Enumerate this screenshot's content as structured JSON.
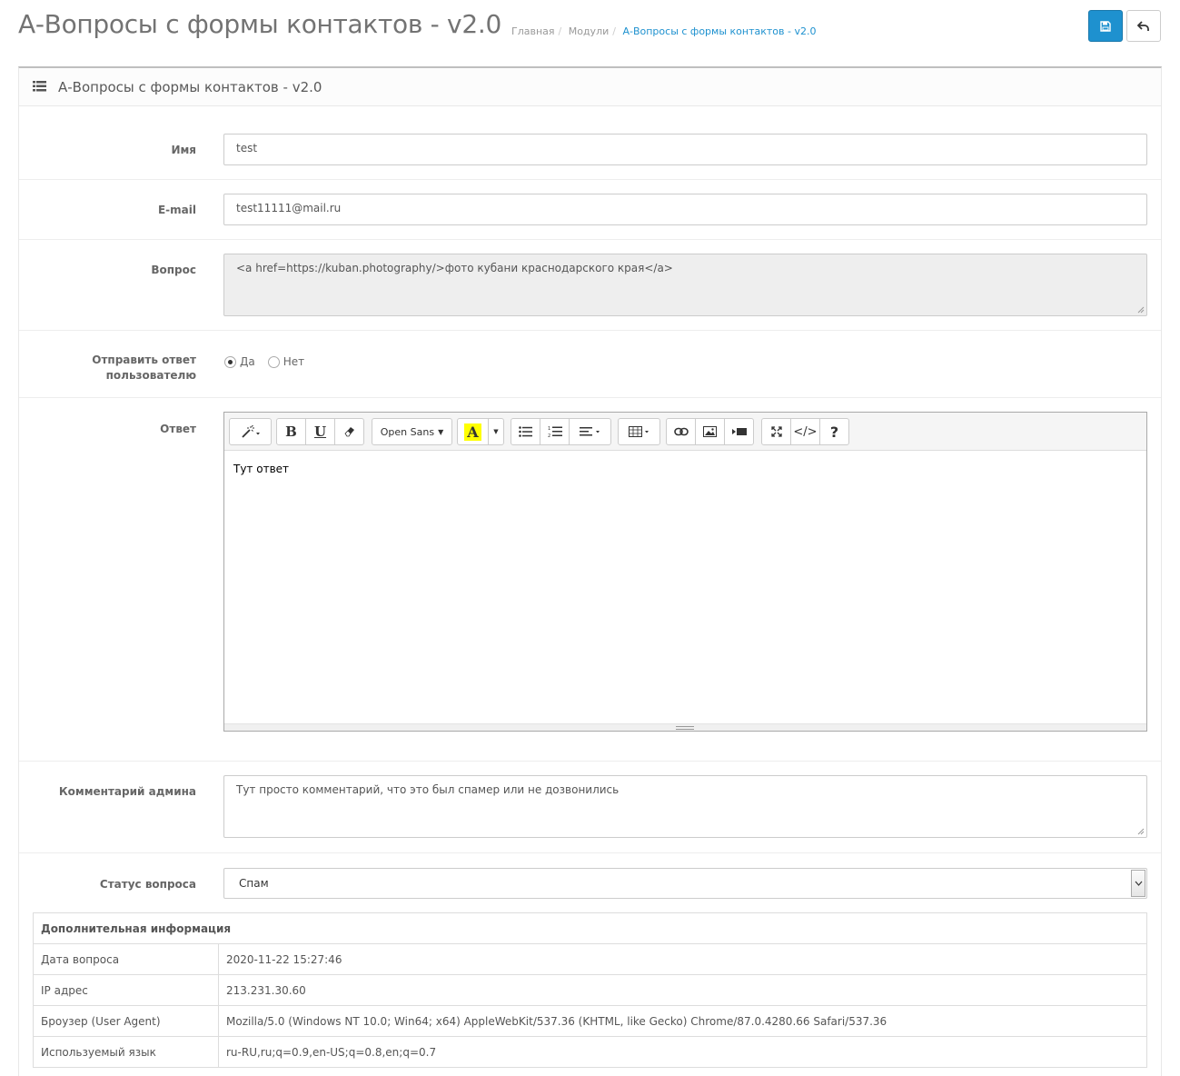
{
  "header": {
    "title": "А-Вопросы с формы контактов - v2.0",
    "breadcrumb": [
      "Главная",
      "Модули",
      "А-Вопросы с формы контактов - v2.0"
    ],
    "save_icon": "save-icon",
    "back_icon": "reply-icon"
  },
  "panel": {
    "icon": "list-icon",
    "title": "А-Вопросы с формы контактов - v2.0"
  },
  "form": {
    "name": {
      "label": "Имя",
      "value": "test"
    },
    "email": {
      "label": "E-mail",
      "value": "test11111@mail.ru"
    },
    "question": {
      "label": "Вопрос",
      "value": "<a href=https://kuban.photography/>фото кубани краснодарского края</a>"
    },
    "send_reply": {
      "label": "Отправить ответ пользователю",
      "options": [
        "Да",
        "Нет"
      ],
      "selected": "Да"
    },
    "answer": {
      "label": "Ответ",
      "content": "Тут ответ",
      "font_dropdown": "Open Sans"
    },
    "admin_comment": {
      "label": "Комментарий админа",
      "value": "Тут просто комментарий, что это был спамер или не дозвонились"
    },
    "status": {
      "label": "Статус вопроса",
      "value": "Спам"
    }
  },
  "info": {
    "heading": "Дополнительная информация",
    "rows": [
      {
        "key": "Дата вопроса",
        "value": "2020-11-22 15:27:46"
      },
      {
        "key": "IP адрес",
        "value": "213.231.30.60"
      },
      {
        "key": "Броузер (User Agent)",
        "value": "Mozilla/5.0 (Windows NT 10.0; Win64; x64) AppleWebKit/537.36 (KHTML, like Gecko) Chrome/87.0.4280.66 Safari/537.36"
      },
      {
        "key": "Используемый язык",
        "value": "ru-RU,ru;q=0.9,en-US;q=0.8,en;q=0.7"
      }
    ]
  },
  "colors": {
    "primary": "#1e91cf",
    "link": "#1e91cf"
  }
}
